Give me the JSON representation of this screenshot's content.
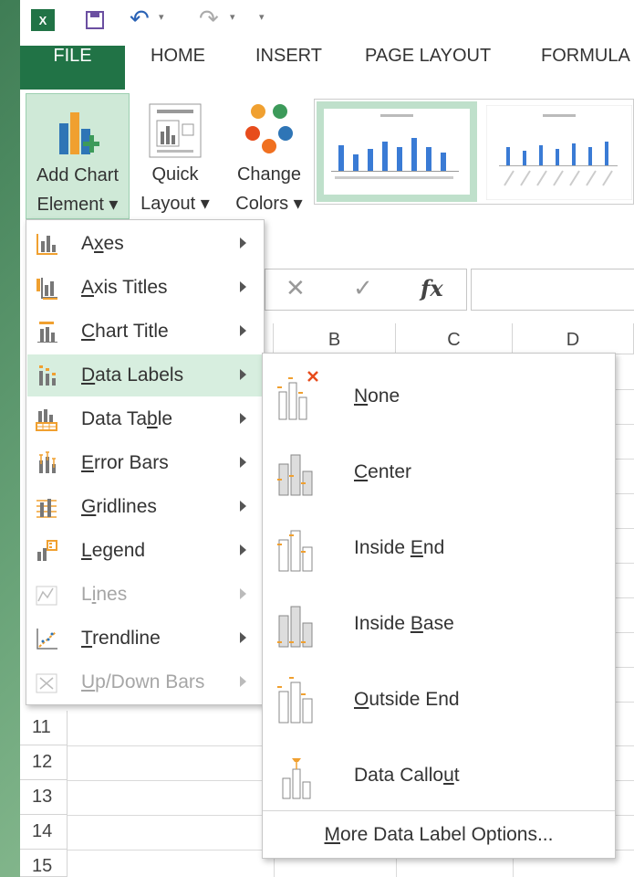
{
  "quick_access": {
    "excel_logo": "X",
    "undo_icon": "undo-icon",
    "redo_icon": "redo-icon"
  },
  "tabs": [
    {
      "label": "FILE"
    },
    {
      "label": "HOME"
    },
    {
      "label": "INSERT"
    },
    {
      "label": "PAGE LAYOUT"
    },
    {
      "label": "FORMULA"
    }
  ],
  "ribbon": {
    "add_chart": {
      "line1": "Add Chart",
      "line2": "Element"
    },
    "quick_layout": {
      "line1": "Quick",
      "line2": "Layout"
    },
    "change_colors": {
      "line1": "Change",
      "line2": "Colors"
    },
    "accent": "#217346"
  },
  "formula_bar": {
    "cancel": "✕",
    "enter": "✓",
    "fx": "fx"
  },
  "columns": [
    "B",
    "C",
    "D"
  ],
  "rows": [
    "11",
    "12",
    "13",
    "14",
    "15"
  ],
  "menu": {
    "items": [
      {
        "pre": "A",
        "u": "x",
        "post": "es",
        "enabled": true,
        "icon": "axes-icon"
      },
      {
        "pre": "",
        "u": "A",
        "post": "xis Titles",
        "enabled": true,
        "icon": "axis-titles-icon"
      },
      {
        "pre": "",
        "u": "C",
        "post": "hart Title",
        "enabled": true,
        "icon": "chart-title-icon"
      },
      {
        "pre": "",
        "u": "D",
        "post": "ata Labels",
        "enabled": true,
        "icon": "data-labels-icon"
      },
      {
        "pre": "Data Ta",
        "u": "b",
        "post": "le",
        "enabled": true,
        "icon": "data-table-icon"
      },
      {
        "pre": "",
        "u": "E",
        "post": "rror Bars",
        "enabled": true,
        "icon": "error-bars-icon"
      },
      {
        "pre": "",
        "u": "G",
        "post": "ridlines",
        "enabled": true,
        "icon": "gridlines-icon"
      },
      {
        "pre": "",
        "u": "L",
        "post": "egend",
        "enabled": true,
        "icon": "legend-icon"
      },
      {
        "pre": "L",
        "u": "i",
        "post": "nes",
        "enabled": false,
        "icon": "lines-icon"
      },
      {
        "pre": "",
        "u": "T",
        "post": "rendline",
        "enabled": true,
        "icon": "trendline-icon"
      },
      {
        "pre": "",
        "u": "U",
        "post": "p/Down Bars",
        "enabled": false,
        "icon": "up-down-bars-icon"
      }
    ]
  },
  "submenu": {
    "items": [
      {
        "pre": "",
        "u": "N",
        "post": "one",
        "icon": "none-icon"
      },
      {
        "pre": "",
        "u": "C",
        "post": "enter",
        "icon": "center-icon"
      },
      {
        "pre": "Inside ",
        "u": "E",
        "post": "nd",
        "icon": "inside-end-icon"
      },
      {
        "pre": "Inside ",
        "u": "B",
        "post": "ase",
        "icon": "inside-base-icon"
      },
      {
        "pre": "",
        "u": "O",
        "post": "utside End",
        "icon": "outside-end-icon"
      },
      {
        "pre": "Data Callo",
        "u": "u",
        "post": "t",
        "icon": "data-callout-icon"
      }
    ],
    "more": {
      "pre": "",
      "u": "M",
      "post": "ore Data Label Options..."
    }
  }
}
